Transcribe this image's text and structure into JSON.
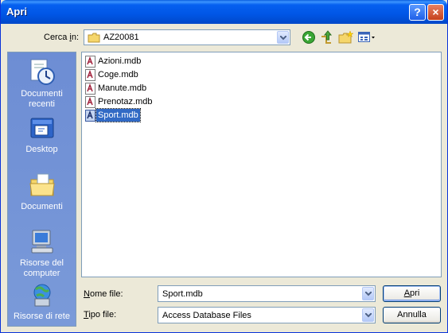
{
  "window": {
    "title": "Apri",
    "help_glyph": "?",
    "close_glyph": "×"
  },
  "toolbar": {
    "look_in_label_pre": "Cerca ",
    "look_in_label_acc": "i",
    "look_in_label_post": "n:",
    "look_in_value": "AZ20081",
    "icons": [
      "back-icon",
      "up-folder-icon",
      "new-folder-icon",
      "view-menu-icon"
    ]
  },
  "places": [
    {
      "label": "Documenti recenti",
      "icon": "recent-documents-icon"
    },
    {
      "label": "Desktop",
      "icon": "desktop-icon"
    },
    {
      "label": "Documenti",
      "icon": "documents-icon"
    },
    {
      "label": "Risorse del computer",
      "icon": "my-computer-icon"
    },
    {
      "label": "Risorse di rete",
      "icon": "network-icon"
    }
  ],
  "files": [
    {
      "name": "Azioni.mdb",
      "selected": false
    },
    {
      "name": "Coge.mdb",
      "selected": false
    },
    {
      "name": "Manute.mdb",
      "selected": false
    },
    {
      "name": "Prenotaz.mdb",
      "selected": false
    },
    {
      "name": "Sport.mdb",
      "selected": true
    }
  ],
  "filename": {
    "label_acc": "N",
    "label_rest": "ome file:",
    "value": "Sport.mdb"
  },
  "filetype": {
    "label_acc": "T",
    "label_rest": "ipo file:",
    "value": "Access Database Files"
  },
  "buttons": {
    "open_acc": "A",
    "open_rest": "pri",
    "cancel": "Annulla"
  },
  "colors": {
    "title_bar": "#0054e3",
    "selection": "#316ac5",
    "places_bar": "#7a97d6",
    "dialog_bg": "#ece9d8"
  }
}
